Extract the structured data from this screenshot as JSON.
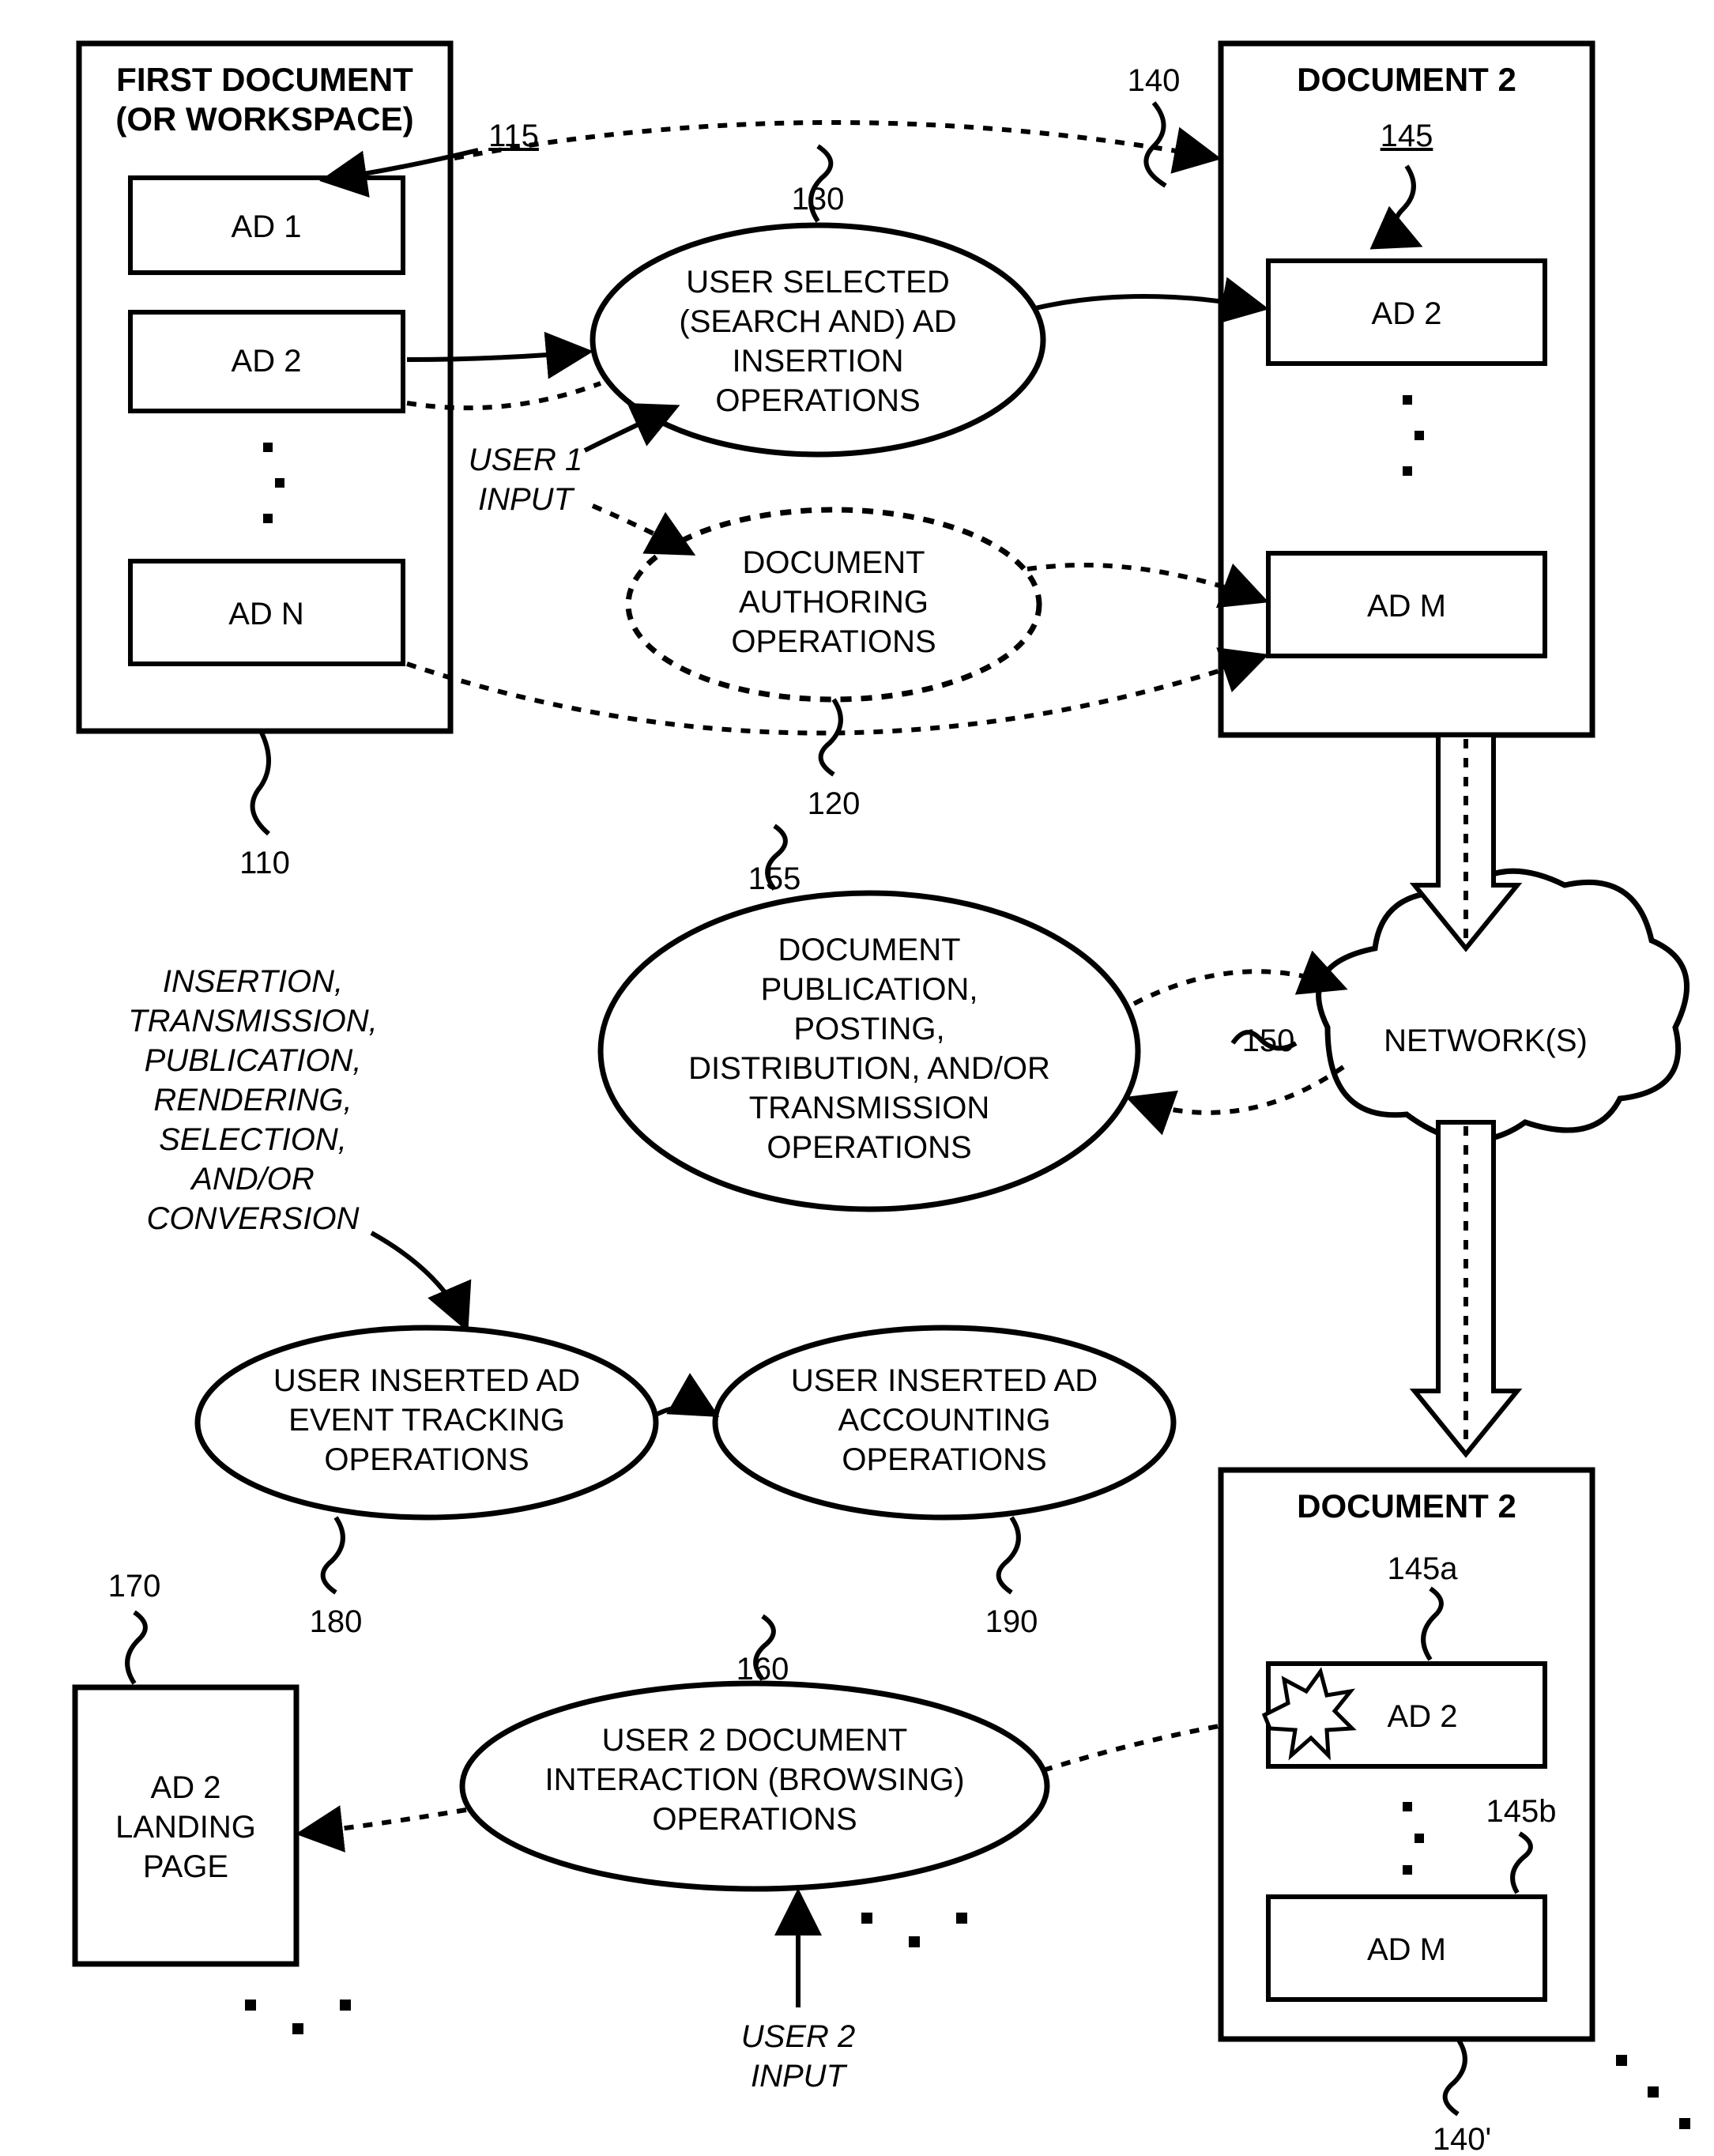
{
  "nodes": {
    "box110": {
      "title1": "FIRST DOCUMENT",
      "title2": "(OR WORKSPACE)",
      "ref": "110"
    },
    "ad1": "AD 1",
    "ad2_left": "AD 2",
    "adn": "AD N",
    "ref115": "115",
    "box140": {
      "title": "DOCUMENT 2",
      "ref": "140"
    },
    "ref145": "145",
    "ad2_right": "AD 2",
    "adm_right": "AD M",
    "oval130": {
      "l1": "USER SELECTED",
      "l2": "(SEARCH AND) AD",
      "l3": "INSERTION",
      "l4": "OPERATIONS",
      "ref": "130"
    },
    "oval120": {
      "l1": "DOCUMENT",
      "l2": "AUTHORING",
      "l3": "OPERATIONS",
      "ref": "120"
    },
    "user1": {
      "l1": "USER 1",
      "l2": "INPUT"
    },
    "oval155": {
      "l1": "DOCUMENT",
      "l2": "PUBLICATION,",
      "l3": "POSTING,",
      "l4": "DISTRIBUTION,  AND/OR",
      "l5": "TRANSMISSION",
      "l6": "OPERATIONS",
      "ref": "155"
    },
    "network": {
      "label": "NETWORK(S)",
      "ref": "150"
    },
    "eventlist": {
      "l1": "INSERTION,",
      "l2": "TRANSMISSION,",
      "l3": "PUBLICATION,",
      "l4": "RENDERING,",
      "l5": "SELECTION,",
      "l6": "AND/OR",
      "l7": "CONVERSION"
    },
    "oval180": {
      "l1": "USER INSERTED AD",
      "l2": "EVENT TRACKING",
      "l3": "OPERATIONS",
      "ref": "180"
    },
    "oval190": {
      "l1": "USER INSERTED AD",
      "l2": "ACCOUNTING",
      "l3": "OPERATIONS",
      "ref": "190"
    },
    "box170": {
      "l1": "AD 2",
      "l2": "LANDING",
      "l3": "PAGE",
      "ref": "170"
    },
    "oval160": {
      "l1": "USER 2 DOCUMENT",
      "l2": "INTERACTION (BROWSING)",
      "l3": "OPERATIONS",
      "ref": "160"
    },
    "user2": {
      "l1": "USER 2",
      "l2": "INPUT"
    },
    "box140p": {
      "title": "DOCUMENT 2",
      "ref": "140'"
    },
    "ad2p": "AD 2",
    "admp": "AD M",
    "ref145a": "145a",
    "ref145b": "145b"
  }
}
